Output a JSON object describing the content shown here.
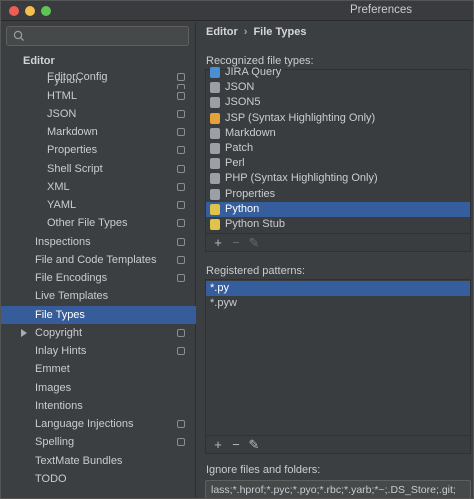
{
  "window": {
    "title": "Preferences"
  },
  "sidebar": {
    "search_placeholder": "",
    "header": "Editor",
    "items": [
      {
        "label": "Python",
        "indent": 3,
        "gear": true,
        "partial": true
      },
      {
        "label": "EditorConfig",
        "indent": 3,
        "gear": true
      },
      {
        "label": "HTML",
        "indent": 3,
        "gear": true
      },
      {
        "label": "JSON",
        "indent": 3,
        "gear": true
      },
      {
        "label": "Markdown",
        "indent": 3,
        "gear": true
      },
      {
        "label": "Properties",
        "indent": 3,
        "gear": true
      },
      {
        "label": "Shell Script",
        "indent": 3,
        "gear": true
      },
      {
        "label": "XML",
        "indent": 3,
        "gear": true
      },
      {
        "label": "YAML",
        "indent": 3,
        "gear": true
      },
      {
        "label": "Other File Types",
        "indent": 3,
        "gear": true
      },
      {
        "label": "Inspections",
        "indent": 2,
        "gear": true
      },
      {
        "label": "File and Code Templates",
        "indent": 2,
        "gear": true
      },
      {
        "label": "File Encodings",
        "indent": 2,
        "gear": true
      },
      {
        "label": "Live Templates",
        "indent": 2,
        "gear": false
      },
      {
        "label": "File Types",
        "indent": 2,
        "gear": false,
        "selected": true
      },
      {
        "label": "Copyright",
        "indent": 2,
        "gear": true,
        "expandable": true
      },
      {
        "label": "Inlay Hints",
        "indent": 2,
        "gear": true
      },
      {
        "label": "Emmet",
        "indent": 2,
        "gear": false
      },
      {
        "label": "Images",
        "indent": 2,
        "gear": false
      },
      {
        "label": "Intentions",
        "indent": 2,
        "gear": false
      },
      {
        "label": "Language Injections",
        "indent": 2,
        "gear": true
      },
      {
        "label": "Spelling",
        "indent": 2,
        "gear": true
      },
      {
        "label": "TextMate Bundles",
        "indent": 2,
        "gear": false
      },
      {
        "label": "TODO",
        "indent": 2,
        "gear": false
      }
    ]
  },
  "main": {
    "breadcrumb": {
      "parent": "Editor",
      "separator": "›",
      "current": "File Types"
    },
    "recognized_label": "Recognized file types:",
    "file_types": [
      {
        "label": "JIRA Query",
        "icon_color": "#4a8fd6",
        "partial": true
      },
      {
        "label": "JSON",
        "icon_color": "#9aa0a6"
      },
      {
        "label": "JSON5",
        "icon_color": "#9aa0a6"
      },
      {
        "label": "JSP (Syntax Highlighting Only)",
        "icon_color": "#e5a13a"
      },
      {
        "label": "Markdown",
        "icon_color": "#9aa0a6"
      },
      {
        "label": "Patch",
        "icon_color": "#9aa0a6"
      },
      {
        "label": "Perl",
        "icon_color": "#9aa0a6"
      },
      {
        "label": "PHP (Syntax Highlighting Only)",
        "icon_color": "#9aa0a6"
      },
      {
        "label": "Properties",
        "icon_color": "#9aa0a6"
      },
      {
        "label": "Python",
        "icon_color": "#e0c34a",
        "selected": true
      },
      {
        "label": "Python Stub",
        "icon_color": "#e0c34a"
      }
    ],
    "file_types_toolbar": {
      "add": "+",
      "remove": "−",
      "edit": "✎"
    },
    "patterns_label": "Registered patterns:",
    "patterns": [
      {
        "label": "*.py",
        "selected": true
      },
      {
        "label": "*.pyw"
      }
    ],
    "patterns_toolbar": {
      "add": "+",
      "remove": "−",
      "edit": "✎"
    },
    "ignore_label": "Ignore files and folders:",
    "ignore_value": "lass;*.hprof;*.pyc;*.pyo;*.rbc;*.yarb;*~;.DS_Store;.git;"
  },
  "colors": {
    "selection": "#365d9c",
    "background": "#3c3f41"
  }
}
